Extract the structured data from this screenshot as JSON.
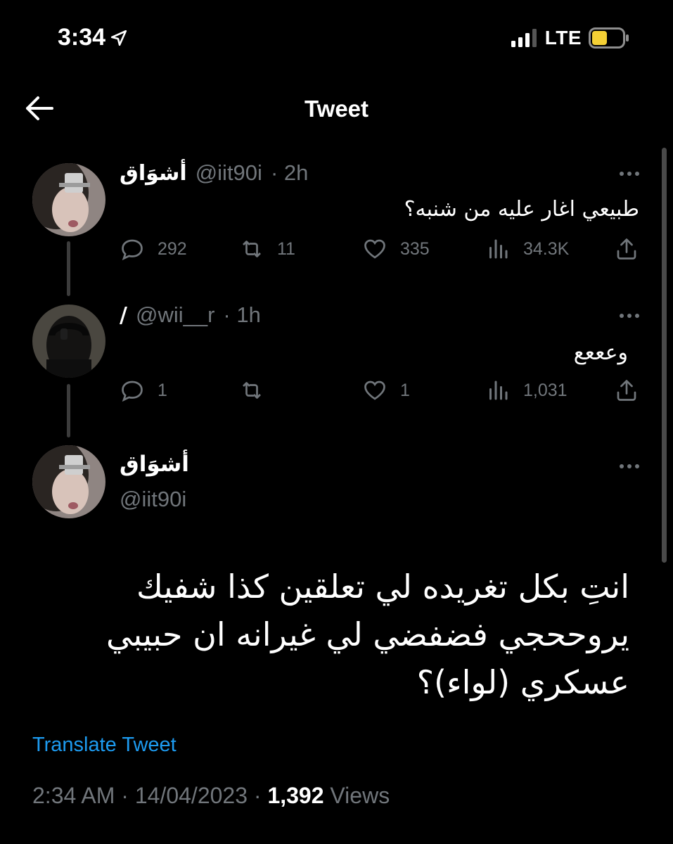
{
  "status_bar": {
    "time": "3:34",
    "network": "LTE"
  },
  "header": {
    "title": "Tweet"
  },
  "colors": {
    "link": "#1d9bf0",
    "secondary": "#71767b",
    "battery": "#f4d035"
  },
  "thread": [
    {
      "name": "أشوَاق",
      "handle": "@iit90i",
      "time": "· 2h",
      "text": "طبيعي اغار عليه من شنبه؟",
      "replies": "292",
      "retweets": "11",
      "likes": "335",
      "views": "34.3K"
    },
    {
      "name": "/",
      "handle": "@wii__r",
      "time": "· 1h",
      "text": "وعععع",
      "replies": "1",
      "retweets": "",
      "likes": "1",
      "views": "1,031"
    }
  ],
  "main_tweet": {
    "name": "أشوَاق",
    "handle": "@iit90i",
    "lines": [
      "انتِ بكل تغريده لي تعلقين كذا شفيك",
      "يروححجي فضفضي لي غيرانه ان حبيبي",
      "عسكري (لواء)؟"
    ],
    "translate_label": "Translate Tweet",
    "timestamp": "2:34 AM · 14/04/2023 ·",
    "views_count": "1,392",
    "views_label": "Views"
  }
}
